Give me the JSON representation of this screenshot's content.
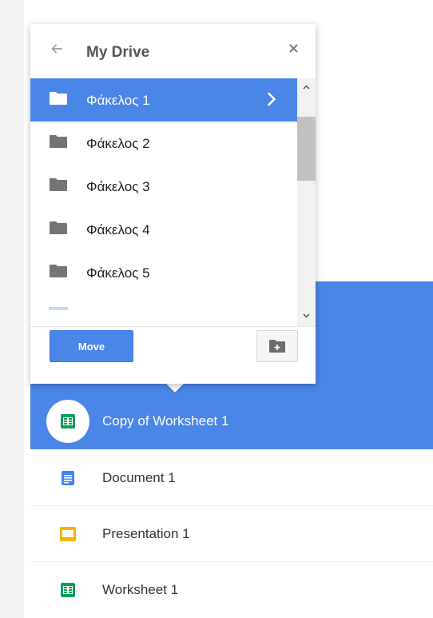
{
  "dialog": {
    "title": "My Drive",
    "back_icon": "arrow-left-icon",
    "close_icon": "close-icon",
    "folders": [
      {
        "label": "Φάκελος 1",
        "active": true
      },
      {
        "label": "Φάκελος 2",
        "active": false
      },
      {
        "label": "Φάκελος 3",
        "active": false
      },
      {
        "label": "Φάκελος 4",
        "active": false
      },
      {
        "label": "Φάκελος 5",
        "active": false
      }
    ],
    "move_label": "Move",
    "new_folder_icon": "new-folder-icon"
  },
  "files": [
    {
      "label": "Copy of Worksheet 1",
      "type": "sheets",
      "selected": true
    },
    {
      "label": "Document 1",
      "type": "docs",
      "selected": false
    },
    {
      "label": "Presentation 1",
      "type": "slides",
      "selected": false
    },
    {
      "label": "Worksheet 1",
      "type": "sheets",
      "selected": false
    }
  ],
  "colors": {
    "accent": "#4a86e8",
    "folder_gray": "#757575",
    "sheets_green": "#0f9d58",
    "docs_blue": "#4285f4",
    "slides_yellow": "#f4b400"
  }
}
